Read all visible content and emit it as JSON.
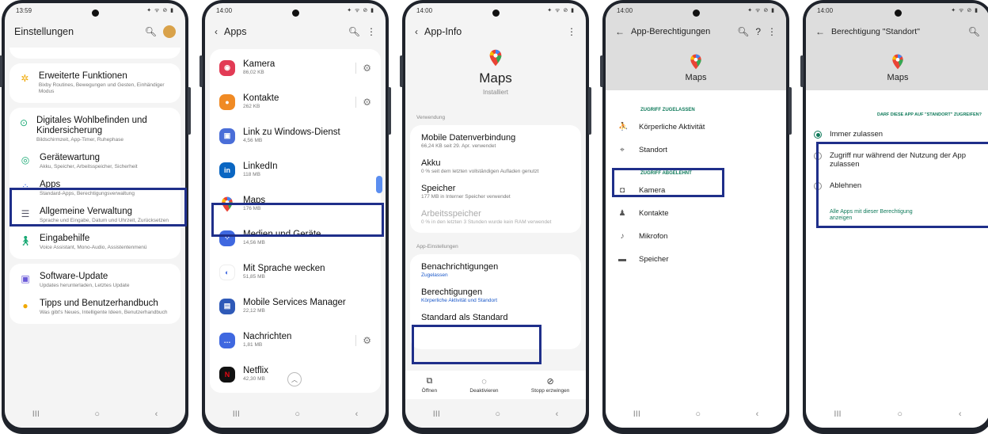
{
  "colors": {
    "highlight": "#1f2f8a",
    "link_blue": "#1a58c9",
    "green": "#0f7a5a"
  },
  "screen1": {
    "time": "13:59",
    "status_icons": "✦ ᯤ ⊘ ▮",
    "title": "Einstellungen",
    "items": [
      {
        "label": "Erweiterte Funktionen",
        "sub": "Bixby Routines, Bewegungen und Gesten, Einhändiger Modus",
        "icon": "star-gear-icon",
        "color": "#f0a800"
      },
      {
        "label": "Digitales Wohlbefinden und Kindersicherung",
        "sub": "Bildschirmzeit, App-Timer, Ruhephase",
        "icon": "wellbeing-icon",
        "color": "#19a974"
      },
      {
        "label": "Gerätewartung",
        "sub": "Akku, Speicher, Arbeitsspeicher, Sicherheit",
        "icon": "device-care-icon",
        "color": "#19a974"
      },
      {
        "label": "Apps",
        "sub": "Standard-Apps, Berechtigungsverwaltung",
        "icon": "apps-grid-icon",
        "color": "#3c6ee0"
      },
      {
        "label": "Allgemeine Verwaltung",
        "sub": "Sprache und Eingabe, Datum und Uhrzeit, Zurücksetzen",
        "icon": "sliders-icon",
        "color": "#556"
      },
      {
        "label": "Eingabehilfe",
        "sub": "Voice Assistant, Mono-Audio, Assistentenmenü",
        "icon": "accessibility-icon",
        "color": "#19a974"
      },
      {
        "label": "Software-Update",
        "sub": "Updates herunterladen, Letztes Update",
        "icon": "update-icon",
        "color": "#6a5ad8"
      },
      {
        "label": "Tipps und Benutzerhandbuch",
        "sub": "Was gibt's Neues, Intelligente Ideen, Benutzerhandbuch",
        "icon": "bulb-icon",
        "color": "#f0a800"
      }
    ]
  },
  "screen2": {
    "time": "14:00",
    "status_icons": "✦ ᯤ ⊘ ▮",
    "title": "Apps",
    "apps": [
      {
        "name": "Kamera",
        "size": "86,02 KB",
        "icon": "camera-icon",
        "color": "#e23b55",
        "glyph": "◉",
        "gear": true
      },
      {
        "name": "Kontakte",
        "size": "262 KB",
        "icon": "contacts-icon",
        "color": "#f08a24",
        "glyph": "●",
        "gear": true
      },
      {
        "name": "Link zu Windows-Dienst",
        "size": "4,56 MB",
        "icon": "link-windows-icon",
        "color": "#4a6ed8",
        "glyph": "▣",
        "gear": false
      },
      {
        "name": "LinkedIn",
        "size": "118 MB",
        "icon": "linkedin-icon",
        "color": "#0a66c2",
        "glyph": "in",
        "gear": false
      },
      {
        "name": "Maps",
        "size": "176 MB",
        "icon": "maps-icon",
        "color": "",
        "glyph": "",
        "gear": false
      },
      {
        "name": "Medien und Geräte",
        "size": "14,56 MB",
        "icon": "media-devices-icon",
        "color": "#3f68e0",
        "glyph": "⁘",
        "gear": false
      },
      {
        "name": "Mit Sprache wecken",
        "size": "51,85 MB",
        "icon": "voice-wake-icon",
        "color": "#fff",
        "glyph": "◐",
        "gear": false
      },
      {
        "name": "Mobile Services Manager",
        "size": "22,12 MB",
        "icon": "mobile-services-icon",
        "color": "#2f5ab8",
        "glyph": "▤",
        "gear": false
      },
      {
        "name": "Nachrichten",
        "size": "1,81 MB",
        "icon": "messages-icon",
        "color": "#3f68e0",
        "glyph": "…",
        "gear": true
      },
      {
        "name": "Netflix",
        "size": "42,30 MB",
        "icon": "netflix-icon",
        "color": "#111",
        "glyph": "N",
        "gear": false
      }
    ]
  },
  "screen3": {
    "time": "14:00",
    "status_icons": "✦ ᯤ ⊘ ▮",
    "title": "App-Info",
    "app_name": "Maps",
    "app_status": "Installiert",
    "section_usage": "Verwendung",
    "usage": [
      {
        "label": "Mobile Datenverbindung",
        "sub": "66,24 KB seit 29. Apr. verwendet",
        "grey": false
      },
      {
        "label": "Akku",
        "sub": "0 % seit dem letzten vollständigen Aufladen genutzt",
        "grey": false
      },
      {
        "label": "Speicher",
        "sub": "177 MB in Interner Speicher verwendet",
        "grey": false
      },
      {
        "label": "Arbeitsspeicher",
        "sub": "0 % in den letzten 3 Stunden wurde kein RAM verwendet",
        "grey": true
      }
    ],
    "section_settings": "App-Einstellungen",
    "notif_label": "Benachrichtigungen",
    "notif_sub": "Zugelassen",
    "perm_label": "Berechtigungen",
    "perm_sub": "Körperliche Aktivität und Standort",
    "next_label": "Standard als Standard",
    "actions": [
      {
        "label": "Öffnen",
        "glyph": "⧉"
      },
      {
        "label": "Deaktivieren",
        "glyph": "◌"
      },
      {
        "label": "Stopp erzwingen",
        "glyph": "⊘"
      }
    ]
  },
  "screen4": {
    "time": "14:00",
    "status_icons": "✦ ᯤ ⊘ ▮",
    "title": "App-Berechtigungen",
    "app_name": "Maps",
    "allowed_header": "ZUGRIFF ZUGELASSEN",
    "allowed": [
      {
        "label": "Körperliche Aktivität",
        "icon": "activity-icon",
        "glyph": "⛹"
      },
      {
        "label": "Standort",
        "icon": "location-icon",
        "glyph": "⌖"
      }
    ],
    "denied_header": "ZUGRIFF ABGELEHNT",
    "denied": [
      {
        "label": "Kamera",
        "icon": "camera-icon",
        "glyph": "◘"
      },
      {
        "label": "Kontakte",
        "icon": "contacts-icon",
        "glyph": "♟"
      },
      {
        "label": "Mikrofon",
        "icon": "microphone-icon",
        "glyph": "♪"
      },
      {
        "label": "Speicher",
        "icon": "folder-icon",
        "glyph": "▬"
      }
    ]
  },
  "screen5": {
    "time": "14:00",
    "status_icons": "✦ ᯤ ⊘ ▮",
    "title": "Berechtigung \"Standort\"",
    "app_name": "Maps",
    "question": "DARF DIESE APP AUF \"STANDORT\" ZUGREIFEN?",
    "options": [
      {
        "label": "Immer zulassen",
        "selected": true
      },
      {
        "label": "Zugriff nur während der Nutzung der App zulassen",
        "selected": false
      },
      {
        "label": "Ablehnen",
        "selected": false
      }
    ],
    "all_apps_link": "Alle Apps mit dieser Berechtigung anzeigen"
  },
  "nav": {
    "recents": "III",
    "home": "○",
    "back": "‹"
  }
}
